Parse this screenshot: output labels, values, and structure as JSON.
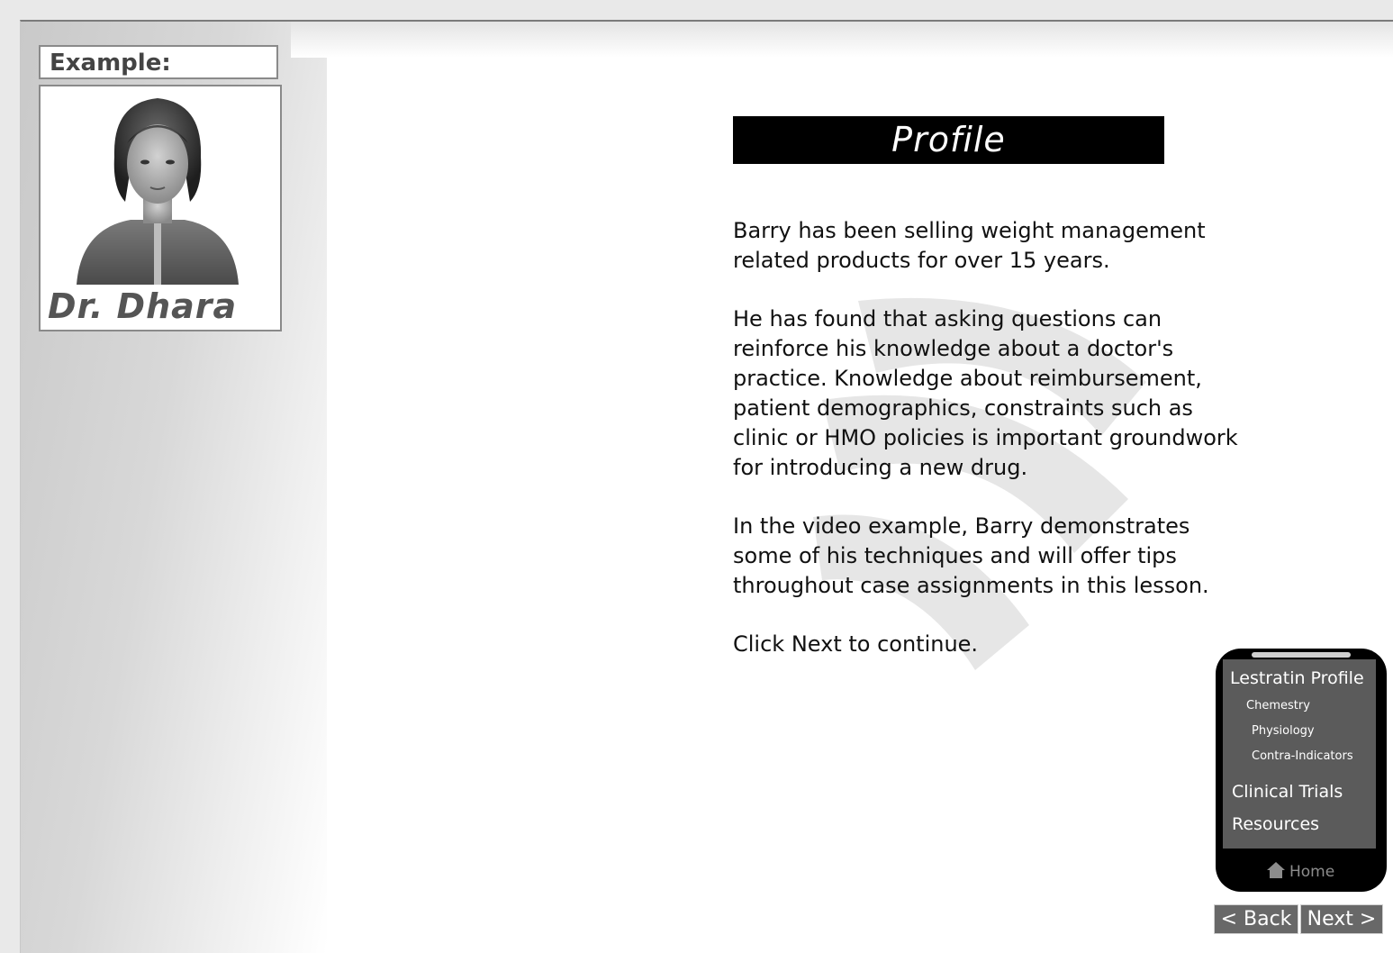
{
  "sidebar": {
    "example_label": "Example:",
    "character_name": "Dr. Dhara"
  },
  "main": {
    "title": "Profile",
    "paragraphs": [
      "Barry has been selling weight management related products for over 15 years.",
      "He has found that asking questions can reinforce his knowledge about a doctor's practice. Knowledge about reimbursement, patient demographics, constraints such as clinic or HMO policies is important groundwork for introducing a new drug.",
      "In the video example, Barry demonstrates some of his techniques and will offer tips throughout case assignments in this lesson.",
      "Click Next to continue."
    ]
  },
  "nav_panel": {
    "items": [
      {
        "label": "Lestratin Profile"
      },
      {
        "label": "Chemestry"
      },
      {
        "label": "Physiology"
      },
      {
        "label": "Contra-Indicators"
      },
      {
        "label": "Clinical Trials"
      },
      {
        "label": "Resources"
      }
    ],
    "home_label": "Home"
  },
  "buttons": {
    "back": "< Back",
    "next": "Next >"
  },
  "icons": {
    "home": "home-icon"
  }
}
